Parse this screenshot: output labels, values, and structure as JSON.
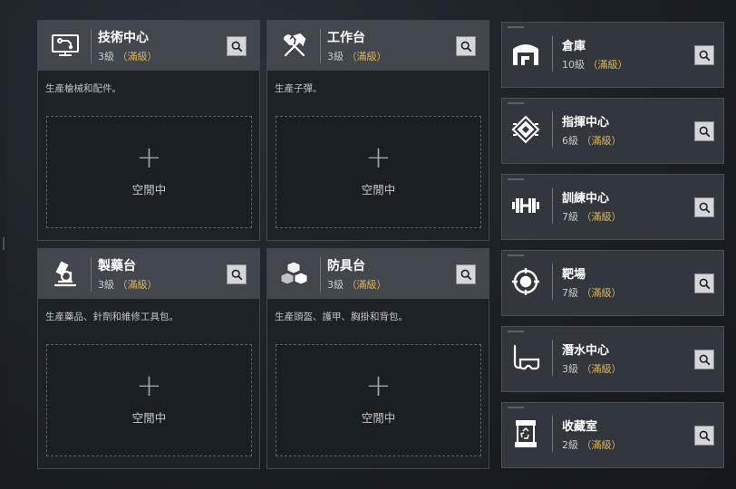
{
  "stations": [
    {
      "id": "tech-center",
      "icon": "computer-icon",
      "title": "技術中心",
      "level": "3級",
      "maxed": "（滿級）",
      "desc": "生產槍械和配件。",
      "slot_plus": "+",
      "slot_label": "空閒中"
    },
    {
      "id": "workbench",
      "icon": "hammer-wrench-icon",
      "title": "工作台",
      "level": "3級",
      "maxed": "（滿級）",
      "desc": "生產子彈。",
      "slot_plus": "+",
      "slot_label": "空閒中"
    },
    {
      "id": "pharmacy",
      "icon": "microscope-icon",
      "title": "製藥台",
      "level": "3級",
      "maxed": "（滿級）",
      "desc": "生產藥品、針劑和維修工具包。",
      "slot_plus": "+",
      "slot_label": "空閒中"
    },
    {
      "id": "armor-bench",
      "icon": "cubes-icon",
      "title": "防具台",
      "level": "3級",
      "maxed": "（滿級）",
      "desc": "生產頭盔、護甲、胸掛和背包。",
      "slot_plus": "+",
      "slot_label": "空閒中"
    }
  ],
  "facilities": [
    {
      "id": "warehouse",
      "icon": "warehouse-icon",
      "title": "倉庫",
      "level": "10級",
      "maxed": "（滿級）"
    },
    {
      "id": "command-center",
      "icon": "command-emblem-icon",
      "title": "指揮中心",
      "level": "6級",
      "maxed": "（滿級）"
    },
    {
      "id": "training-center",
      "icon": "dumbbell-icon",
      "title": "訓練中心",
      "level": "7級",
      "maxed": "（滿級）"
    },
    {
      "id": "shooting-range",
      "icon": "target-icon",
      "title": "靶場",
      "level": "7級",
      "maxed": "（滿級）"
    },
    {
      "id": "diving-center",
      "icon": "diving-mask-icon",
      "title": "潛水中心",
      "level": "3級",
      "maxed": "（滿級）"
    },
    {
      "id": "collection-room",
      "icon": "recycle-container-icon",
      "title": "收藏室",
      "level": "2級",
      "maxed": "（滿級）"
    }
  ],
  "colors": {
    "maxed": "#e1b451",
    "header": "#41474d",
    "card": "#1d2227"
  }
}
